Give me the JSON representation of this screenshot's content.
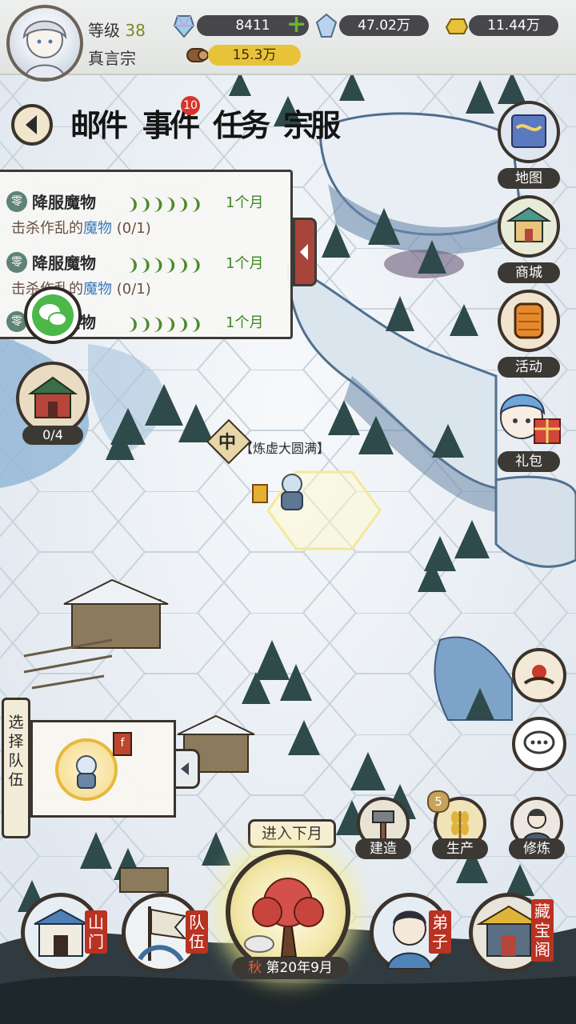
{
  "player": {
    "level_label": "等级",
    "level_value": "38",
    "sect_name": "真言宗"
  },
  "resources": [
    {
      "name": "spirit-stone",
      "value": "8411"
    },
    {
      "name": "crystal",
      "value": "47.02万"
    },
    {
      "name": "gold",
      "value": "11.44万"
    },
    {
      "name": "wood",
      "value": "15.3万"
    }
  ],
  "tabs": [
    {
      "label": "邮件",
      "badge": ""
    },
    {
      "label": "事件",
      "badge": "10"
    },
    {
      "label": "任务",
      "badge": ""
    },
    {
      "label": "宗服",
      "badge": ""
    }
  ],
  "quests": [
    {
      "title": "降服魔物",
      "desc_prefix": "击杀作乱的",
      "desc_highlight": "魔物",
      "progress": "(0/1)",
      "time": "1个月"
    },
    {
      "title": "降服魔物",
      "desc_prefix": "击杀作乱的",
      "desc_highlight": "魔物",
      "progress": "(0/1)",
      "time": "1个月"
    },
    {
      "title": "降服魔物",
      "desc_prefix": "",
      "desc_highlight": "",
      "progress": "",
      "time": "1个月"
    }
  ],
  "side_menu": [
    {
      "label": "地图",
      "icon": "scroll-map-icon"
    },
    {
      "label": "商城",
      "icon": "pavilion-icon"
    },
    {
      "label": "活动",
      "icon": "lantern-icon"
    },
    {
      "label": "礼包",
      "icon": "girl-gift-icon"
    }
  ],
  "building_counter": "0/4",
  "map_marker": {
    "symbol": "中",
    "text": "【炼虚大圆满】"
  },
  "team_panel": {
    "label": "选择队伍",
    "flag": "f"
  },
  "actions": [
    {
      "label": "建造",
      "badge": ""
    },
    {
      "label": "生产",
      "badge": "5"
    },
    {
      "label": "修炼",
      "badge": ""
    }
  ],
  "next_month_label": "进入下月",
  "season": {
    "season": "秋",
    "date": "第20年9月"
  },
  "bottom_nav": [
    {
      "label": "山门"
    },
    {
      "label": "队伍"
    },
    {
      "label": "弟子"
    },
    {
      "label": "藏宝阁"
    }
  ],
  "colors": {
    "accent_red": "#b93222",
    "quest_green": "#3e8a22",
    "highlight_blue": "#3b78b8"
  }
}
